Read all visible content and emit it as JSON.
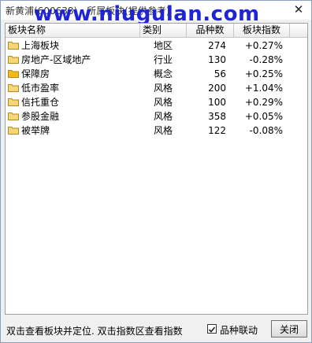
{
  "window": {
    "title": "新黄浦(600638) - 所属板块(提供参考)",
    "watermark": "www.niugulan.com"
  },
  "table": {
    "columns": [
      "板块名称",
      "类别",
      "品种数",
      "板块指数"
    ],
    "rows": [
      {
        "name": "上海板块",
        "type": "地区",
        "count": "274",
        "index": "+0.27%",
        "folder_color": "#f5d77a"
      },
      {
        "name": "房地产-区域地产",
        "type": "行业",
        "count": "130",
        "index": "-0.28%",
        "folder_color": "#f5d77a"
      },
      {
        "name": "保障房",
        "type": "概念",
        "count": "56",
        "index": "+0.25%",
        "folder_color": "#f2b91c"
      },
      {
        "name": "低市盈率",
        "type": "风格",
        "count": "200",
        "index": "+1.04%",
        "folder_color": "#f5d77a"
      },
      {
        "name": "信托重仓",
        "type": "风格",
        "count": "100",
        "index": "+0.29%",
        "folder_color": "#f5d77a"
      },
      {
        "name": "参股金融",
        "type": "风格",
        "count": "358",
        "index": "+0.05%",
        "folder_color": "#f5d77a"
      },
      {
        "name": "被举牌",
        "type": "风格",
        "count": "122",
        "index": "-0.08%",
        "folder_color": "#f5d77a"
      }
    ]
  },
  "footer": {
    "hint": "双击查看板块并定位. 双击指数区查看指数",
    "link_checkbox_label": "品种联动",
    "link_checkbox_checked": true,
    "close_label": "关闭"
  }
}
